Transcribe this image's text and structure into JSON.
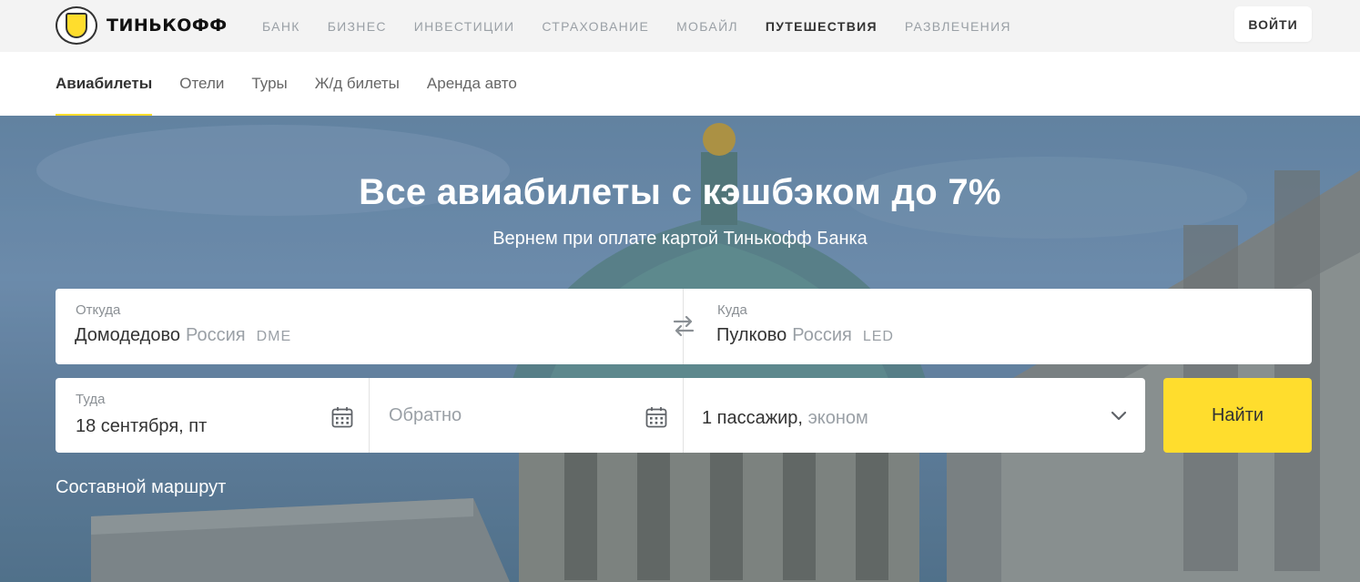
{
  "brand": {
    "name": "ТИНЬКОФФ"
  },
  "topnav": {
    "items": [
      "БАНК",
      "БИЗНЕС",
      "ИНВЕСТИЦИИ",
      "СТРАХОВАНИЕ",
      "МОБАЙЛ",
      "ПУТЕШЕСТВИЯ",
      "РАЗВЛЕЧЕНИЯ"
    ],
    "active": "ПУТЕШЕСТВИЯ",
    "login_label": "ВОЙТИ"
  },
  "subnav": {
    "items": [
      "Авиабилеты",
      "Отели",
      "Туры",
      "Ж/д билеты",
      "Аренда авто"
    ],
    "active": "Авиабилеты"
  },
  "hero": {
    "title": "Все авиабилеты с кэшбэком до 7%",
    "subtitle": "Вернем при оплате картой Тинькофф Банка"
  },
  "search": {
    "from": {
      "label": "Откуда",
      "city": "Домодедово",
      "country": "Россия",
      "code": "DME"
    },
    "to": {
      "label": "Куда",
      "city": "Пулково",
      "country": "Россия",
      "code": "LED"
    },
    "depart": {
      "label": "Туда",
      "value": "18 сентября, пт"
    },
    "return": {
      "placeholder": "Обратно"
    },
    "passengers": {
      "count_text": "1 пассажир,",
      "class_text": "эконом"
    },
    "submit_label": "Найти",
    "multi_route_label": "Составной маршрут"
  },
  "colors": {
    "accent": "#ffdd2d",
    "topbar_bg": "#f3f3f3",
    "text": "#333333",
    "muted": "#9aa0a6"
  },
  "icons": [
    "tinkoff-logo-icon",
    "swap-arrows-icon",
    "calendar-icon",
    "chevron-down-icon"
  ]
}
